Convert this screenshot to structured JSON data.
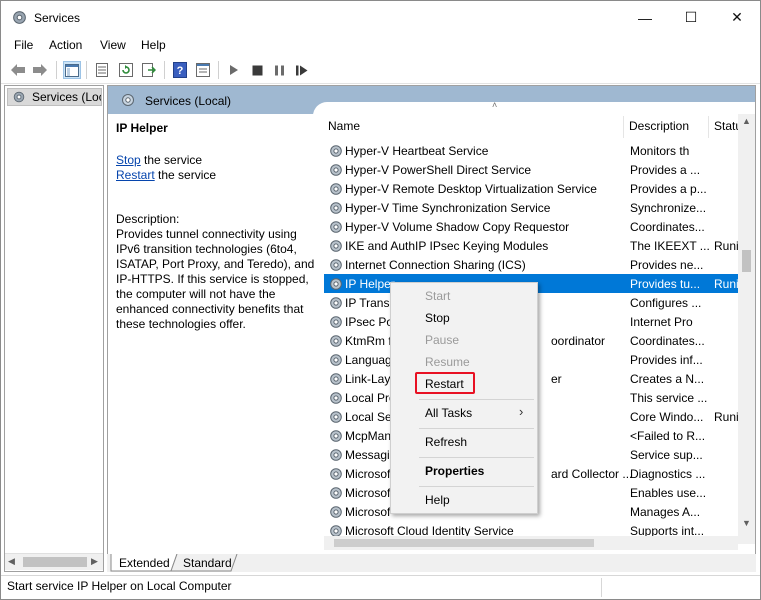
{
  "window": {
    "title": "Services",
    "controls": {
      "minimize": "—",
      "maximize": "☐",
      "close": "✕"
    }
  },
  "menubar": {
    "items": [
      "File",
      "Action",
      "View",
      "Help"
    ]
  },
  "tree": {
    "root_label": "Services (Local)"
  },
  "header": {
    "title": "Services (Local)"
  },
  "detail": {
    "service_name": "IP Helper",
    "stop_link": "Stop",
    "stop_suffix": " the service",
    "restart_link": "Restart",
    "restart_suffix": " the service",
    "description_label": "Description:",
    "description_lines": [
      "Provides tunnel connectivity using",
      "IPv6 transition technologies (6to4,",
      "ISATAP, Port Proxy, and Teredo), and",
      "IP-HTTPS. If this service is stopped,",
      "the computer will not have the",
      "enhanced connectivity benefits that",
      "these technologies offer."
    ]
  },
  "columns": {
    "name": "Name",
    "description": "Description",
    "status": "Statu"
  },
  "rows": [
    {
      "name": "Hyper-V Heartbeat Service",
      "description": "Monitors th",
      "status": ""
    },
    {
      "name": "Hyper-V PowerShell Direct Service",
      "description": "Provides a ...",
      "status": ""
    },
    {
      "name": "Hyper-V Remote Desktop Virtualization Service",
      "description": "Provides a p...",
      "status": ""
    },
    {
      "name": "Hyper-V Time Synchronization Service",
      "description": "Synchronize...",
      "status": ""
    },
    {
      "name": "Hyper-V Volume Shadow Copy Requestor",
      "description": "Coordinates...",
      "status": ""
    },
    {
      "name": "IKE and AuthIP IPsec Keying Modules",
      "description": "The IKEEXT ...",
      "status": "Runi"
    },
    {
      "name": "Internet Connection Sharing (ICS)",
      "description": "Provides ne...",
      "status": ""
    },
    {
      "name": "IP Helper",
      "description": "Provides tu...",
      "status": "Runi",
      "selected": true
    },
    {
      "name": "IP Transl",
      "description": "Configures ...",
      "status": ""
    },
    {
      "name": "IPsec Po",
      "description": "Internet Pro",
      "status": ""
    },
    {
      "name": "KtmRm f",
      "name_tail": "oordinator",
      "description": "Coordinates...",
      "status": ""
    },
    {
      "name": "Languag",
      "description": "Provides inf...",
      "status": ""
    },
    {
      "name": "Link-Lay",
      "name_tail": "er",
      "description": "Creates a N...",
      "status": ""
    },
    {
      "name": "Local Pro",
      "description": "This service ...",
      "status": ""
    },
    {
      "name": "Local Ses",
      "description": "Core Windo...",
      "status": "Runi"
    },
    {
      "name": "McpMan",
      "description": "<Failed to R...",
      "status": ""
    },
    {
      "name": "Messagin",
      "description": "Service sup...",
      "status": ""
    },
    {
      "name": "Microsof",
      "name_tail": "ard Collector ...",
      "description": "Diagnostics ...",
      "status": ""
    },
    {
      "name": "Microsof",
      "description": "Enables use...",
      "status": ""
    },
    {
      "name": "Microsof",
      "description": "Manages A...",
      "status": ""
    },
    {
      "name": "Microsoft Cloud Identity Service",
      "description": "Supports int...",
      "status": ""
    }
  ],
  "context_menu": {
    "items": [
      {
        "label": "Start",
        "disabled": true
      },
      {
        "label": "Stop",
        "disabled": false
      },
      {
        "label": "Pause",
        "disabled": true
      },
      {
        "label": "Resume",
        "disabled": true
      },
      {
        "label": "Restart",
        "disabled": false,
        "highlighted": true
      },
      {
        "label": "All Tasks",
        "submenu": true
      },
      {
        "label": "Refresh"
      },
      {
        "label": "Properties",
        "bold": true
      },
      {
        "label": "Help"
      }
    ],
    "highlight_color": "#e81123"
  },
  "tabs": {
    "extended": "Extended",
    "standard": "Standard"
  },
  "statusbar": {
    "text": "Start service IP Helper on Local Computer"
  },
  "colors": {
    "selection": "#0078d7",
    "header_band": "#9fb8d1",
    "link": "#0645ad"
  }
}
